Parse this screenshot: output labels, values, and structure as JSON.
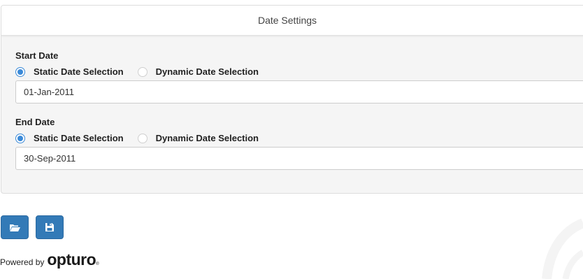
{
  "panel": {
    "title": "Date Settings"
  },
  "start": {
    "label": "Start Date",
    "options": [
      "Static Date Selection",
      "Dynamic Date Selection"
    ],
    "selected": "Static Date Selection",
    "value": "01-Jan-2011"
  },
  "end": {
    "label": "End Date",
    "options": [
      "Static Date Selection",
      "Dynamic Date Selection"
    ],
    "selected": "Static Date Selection",
    "value": "30-Sep-2011"
  },
  "toolbar": {
    "open_icon": "folder-open-icon",
    "save_icon": "save-icon"
  },
  "footer": {
    "powered_by": "Powered by",
    "brand": "opturo",
    "brand_mark": "®"
  },
  "colors": {
    "primary_button": "#337ab7",
    "radio_accent": "#3b8ad8",
    "panel_bg": "#f5f5f5"
  }
}
